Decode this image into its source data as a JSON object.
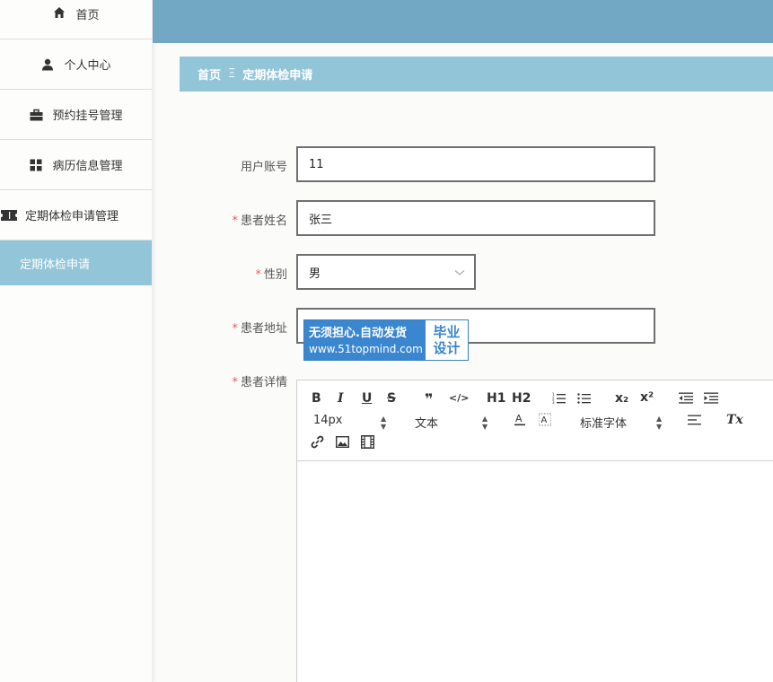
{
  "sidebar": {
    "items": [
      {
        "label": "首页",
        "icon": "home-icon"
      },
      {
        "label": "个人中心",
        "icon": "user-icon"
      },
      {
        "label": "预约挂号管理",
        "icon": "briefcase-icon"
      },
      {
        "label": "病历信息管理",
        "icon": "grid-icon"
      },
      {
        "label": "定期体检申请管理",
        "icon": "ticket-icon"
      }
    ],
    "active_subitem": "定期体检申请"
  },
  "breadcrumb": {
    "home": "首页",
    "separator": "Ξ",
    "current": "定期体检申请"
  },
  "form": {
    "account": {
      "label": "用户账号",
      "value": "11"
    },
    "name": {
      "label": "患者姓名",
      "value": "张三",
      "required_mark": "*"
    },
    "gender": {
      "label": "性别",
      "value": "男",
      "required_mark": "*"
    },
    "address": {
      "label": "患者地址",
      "value": "",
      "required_mark": "*"
    },
    "details": {
      "label": "患者详情",
      "required_mark": "*"
    }
  },
  "editor": {
    "bold": "B",
    "italic": "I",
    "underline": "U",
    "strike": "S",
    "quote": "❞",
    "code": "</>",
    "h1": "H1",
    "h2": "H2",
    "sub": "x₂",
    "sup": "x²",
    "font_size": "14px",
    "block_type": "文本",
    "font_family": "标准字体",
    "clear": "Tx"
  },
  "watermark": {
    "line1": "无须担心.自动发货",
    "line2": "www.51topmind.com",
    "side1": "毕业",
    "side2": "设计"
  },
  "colors": {
    "header": "#73a8c5",
    "accent": "#93c5d8",
    "required": "#e05d5d"
  }
}
